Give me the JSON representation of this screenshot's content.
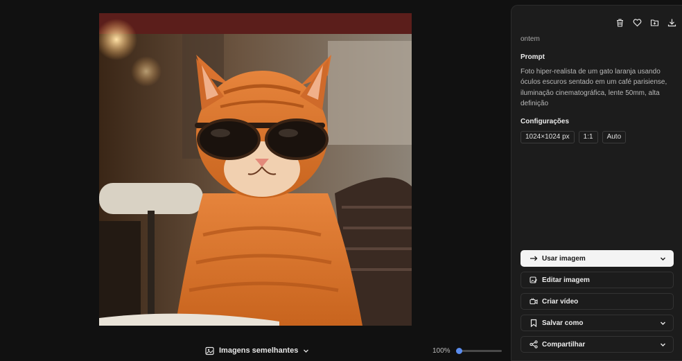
{
  "canvas": {
    "image_alt": "Gato laranja usando óculos escuros em um café"
  },
  "bottom": {
    "similar_label": "Imagens semelhantes",
    "zoom_text": "100%",
    "zoom_level": 0.0
  },
  "panel": {
    "actions": [
      "trash-icon",
      "heart-icon",
      "folder-add-icon",
      "download-icon"
    ],
    "date": "ontem",
    "prompt_title": "Prompt",
    "prompt_text": "Foto hiper-realista de um gato laranja usando óculos escuros sentado em um café parisiense, iluminação cinematográfica, lente 50mm, alta definição",
    "config_title": "Configurações",
    "config_chips": [
      "1024×1024 px",
      "1:1",
      "Auto"
    ],
    "buttons": [
      {
        "label": "Usar imagem",
        "icon": "arrow-right-icon",
        "has_dropdown": true
      },
      {
        "label": "Editar imagem",
        "icon": "edit-image-icon",
        "has_dropdown": false
      },
      {
        "label": "Criar vídeo",
        "icon": "video-icon",
        "has_dropdown": false
      },
      {
        "label": "Salvar como",
        "icon": "bookmark-icon",
        "has_dropdown": true
      },
      {
        "label": "Compartilhar",
        "icon": "share-icon",
        "has_dropdown": true
      }
    ]
  },
  "colors": {
    "background": "#111111",
    "panel": "#1c1c1c",
    "primary_button": "#f4f4f4",
    "accent": "#5b8def"
  }
}
